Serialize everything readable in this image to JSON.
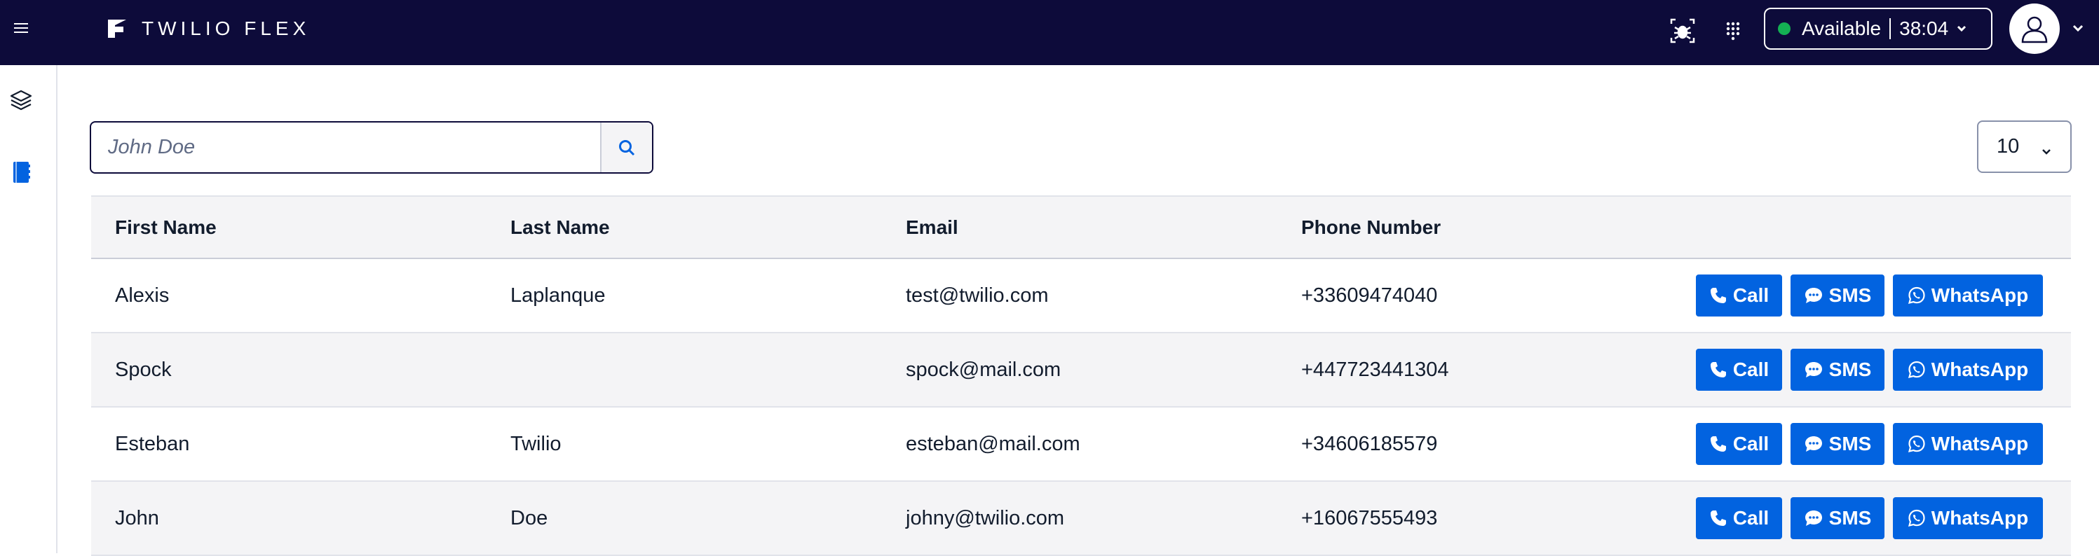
{
  "app": {
    "brand": "TWILIO FLEX"
  },
  "topbar": {
    "status_label": "Available",
    "status_timer": "38:04",
    "status_color": "#14b053",
    "icons": [
      "menu-icon",
      "bug-icon",
      "dialpad-icon",
      "user-icon",
      "chevron-down-icon"
    ]
  },
  "sidenav": {
    "items": [
      {
        "name": "layers-icon"
      },
      {
        "name": "contacts-book-icon",
        "active": true
      }
    ]
  },
  "search": {
    "placeholder": "John Doe"
  },
  "pagination": {
    "page_size": "10"
  },
  "table": {
    "headers": [
      "First Name",
      "Last Name",
      "Email",
      "Phone Number"
    ],
    "rows": [
      {
        "first": "Alexis",
        "last": "Laplanque",
        "email": "test@twilio.com",
        "phone": "+33609474040"
      },
      {
        "first": "Spock",
        "last": "",
        "email": "spock@mail.com",
        "phone": "+447723441304"
      },
      {
        "first": "Esteban",
        "last": "Twilio",
        "email": "esteban@mail.com",
        "phone": "+34606185579"
      },
      {
        "first": "John",
        "last": "Doe",
        "email": "johny@twilio.com",
        "phone": "+16067555493"
      }
    ],
    "actions": {
      "call": "Call",
      "sms": "SMS",
      "whatsapp": "WhatsApp"
    }
  },
  "colors": {
    "topbar_bg": "#0d0b3a",
    "primary_button": "#0263e0"
  }
}
